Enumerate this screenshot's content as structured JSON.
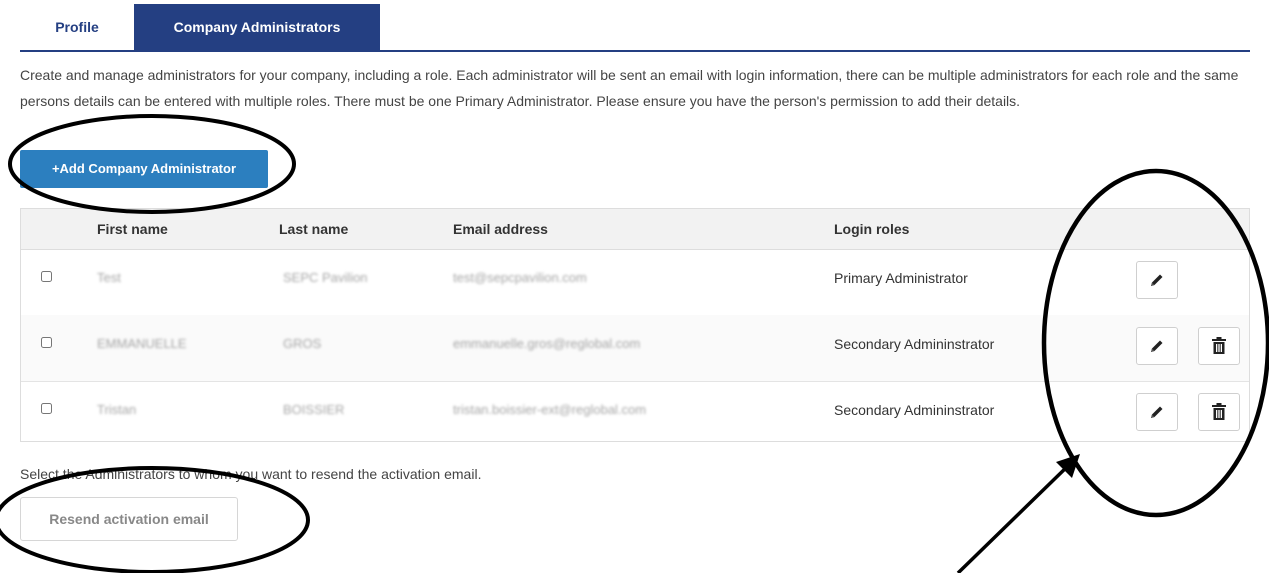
{
  "tabs": {
    "profile": "Profile",
    "admins": "Company Administrators"
  },
  "description": "Create and manage administrators for your company, including a role. Each administrator will be sent an email with login information, there can be multiple administrators for each role and the same persons details can be entered with multiple roles. There must be one Primary Administrator. Please ensure you have the person's permission to add their details.",
  "add_button": "+Add Company Administrator",
  "table": {
    "headers": {
      "first": "First name",
      "last": "Last name",
      "email": "Email address",
      "roles": "Login roles"
    },
    "rows": [
      {
        "first": "Test",
        "last": "SEPC Pavilion",
        "email": "test@sepcpavilion.com",
        "role": "Primary Administrator"
      },
      {
        "first": "EMMANUELLE",
        "last": "GROS",
        "email": "emmanuelle.gros@reglobal.com",
        "role": "Secondary Admininstrator"
      },
      {
        "first": "Tristan",
        "last": "BOISSIER",
        "email": "tristan.boissier-ext@reglobal.com",
        "role": "Secondary Admininstrator"
      }
    ]
  },
  "resend_hint": "Select the Administrators to whom you want to resend the activation email.",
  "resend_button": "Resend activation email",
  "icons": {
    "edit": "pencil-icon",
    "delete": "trash-icon"
  },
  "colors": {
    "tab_active": "#243f82",
    "primary_button": "#2c7fbf",
    "annotation": "#000000"
  }
}
